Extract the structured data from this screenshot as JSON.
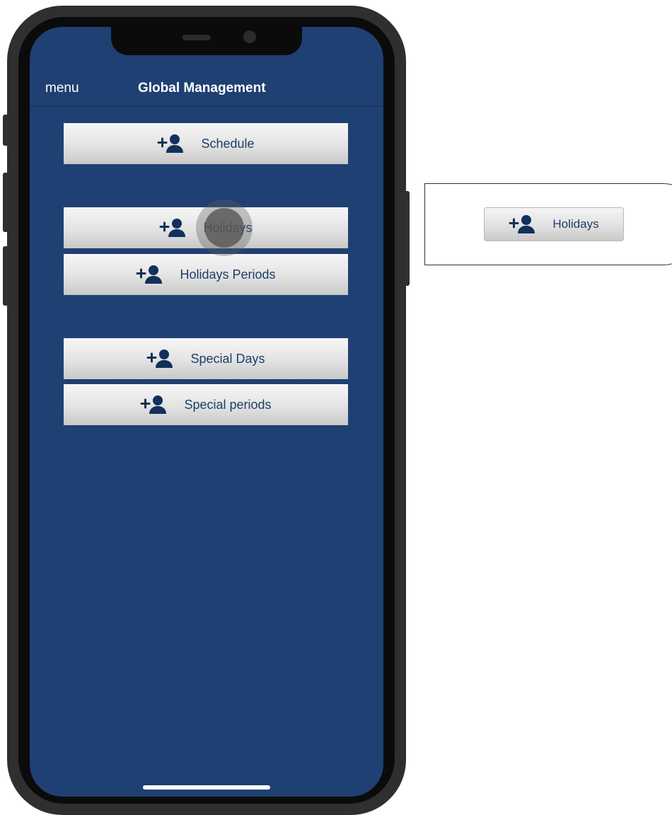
{
  "nav": {
    "menu_label": "menu",
    "title": "Global Management"
  },
  "buttons": [
    {
      "label": "Schedule",
      "icon": "add-person-icon"
    },
    {
      "label": "Holidays",
      "icon": "add-person-icon"
    },
    {
      "label": "Holidays Periods",
      "icon": "add-person-icon"
    },
    {
      "label": "Special Days",
      "icon": "add-person-icon"
    },
    {
      "label": "Special periods",
      "icon": "add-person-icon"
    }
  ],
  "callout": {
    "label": "Holidays",
    "icon": "add-person-icon"
  },
  "colors": {
    "screen_background": "#1f4072",
    "button_text": "#1e3d6b",
    "icon": "#12305c",
    "phone_frame": "#2f2f2f"
  }
}
